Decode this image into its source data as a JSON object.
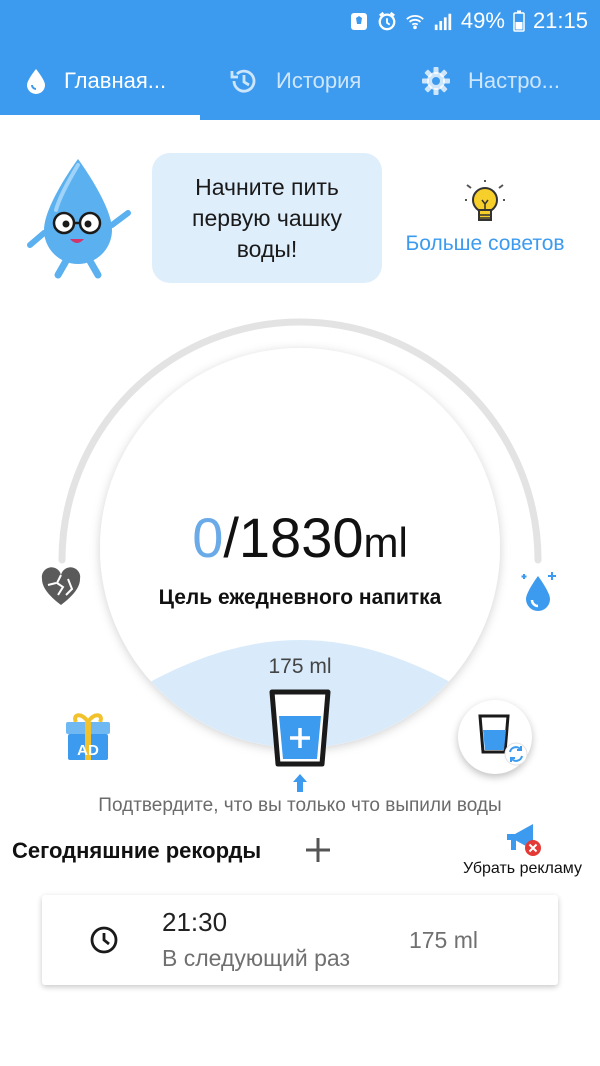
{
  "status_bar": {
    "battery": "49%",
    "time": "21:15"
  },
  "tabs": [
    {
      "label": "Главная...",
      "icon": "water-drop-icon",
      "active": true
    },
    {
      "label": "История",
      "icon": "history-icon",
      "active": false
    },
    {
      "label": "Настро...",
      "icon": "gear-icon",
      "active": false
    }
  ],
  "tip": {
    "bubble_text": "Начните пить первую чашку воды!",
    "more_tips_label": "Больше советов"
  },
  "progress": {
    "current": "0",
    "separator": "/",
    "goal": "1830",
    "unit": "ml",
    "fraction": 0,
    "label": "Цель ежедневного напитка"
  },
  "cup": {
    "size_label": "175 ml"
  },
  "confirm_hint": "Подтвердите, что вы только что выпили воды",
  "records": {
    "title": "Сегодняшние рекорды",
    "remove_ads_label": "Убрать рекламу",
    "items": [
      {
        "time": "21:30",
        "note": "В следующий раз",
        "amount": "175 ml"
      }
    ]
  },
  "colors": {
    "accent": "#3d9bef",
    "bubble": "#dfeefb",
    "water": "#d9ebfb",
    "current_value": "#6aaae8"
  }
}
